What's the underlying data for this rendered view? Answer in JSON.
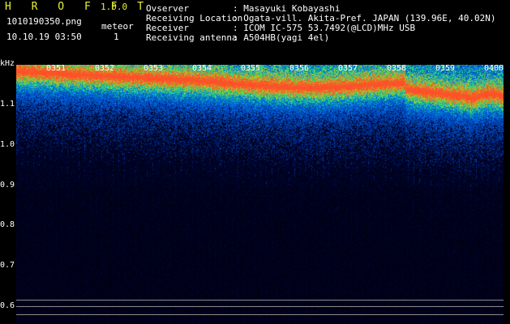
{
  "header": {
    "logo": "H R O F F T",
    "version": "1.0.0",
    "filename": "1010190350.png",
    "datetime": "10.10.19 03:50",
    "counter_label": "meteor",
    "counter_value": "1",
    "fields": [
      {
        "label": "Ovserver",
        "value": ": Masayuki Kobayashi"
      },
      {
        "label": "Receiving Location",
        "value": ": Ogata-vill. Akita-Pref. JAPAN (139.96E, 40.02N)"
      },
      {
        "label": "Receiver",
        "value": ": ICOM IC-575 53.7492(@LCD)MHz USB"
      },
      {
        "label": "Receiving antenna",
        "value": ": A504HB(yagi 4el)"
      }
    ]
  },
  "axes": {
    "y_unit": "kHz",
    "y_ticks": [
      "1.1",
      "1.0",
      "0.9",
      "0.8",
      "0.7",
      "0.6"
    ],
    "x_ticks": [
      "0351",
      "0352",
      "0353",
      "0354",
      "0355",
      "0356",
      "0357",
      "0358",
      "0359",
      "0400"
    ]
  },
  "colors": {
    "logo": "#e8f23a",
    "background": "#000000",
    "low": "#0a1a6a",
    "mid": "#1f6cff",
    "high": "#33e07a",
    "peak": "#ff5a20"
  }
}
